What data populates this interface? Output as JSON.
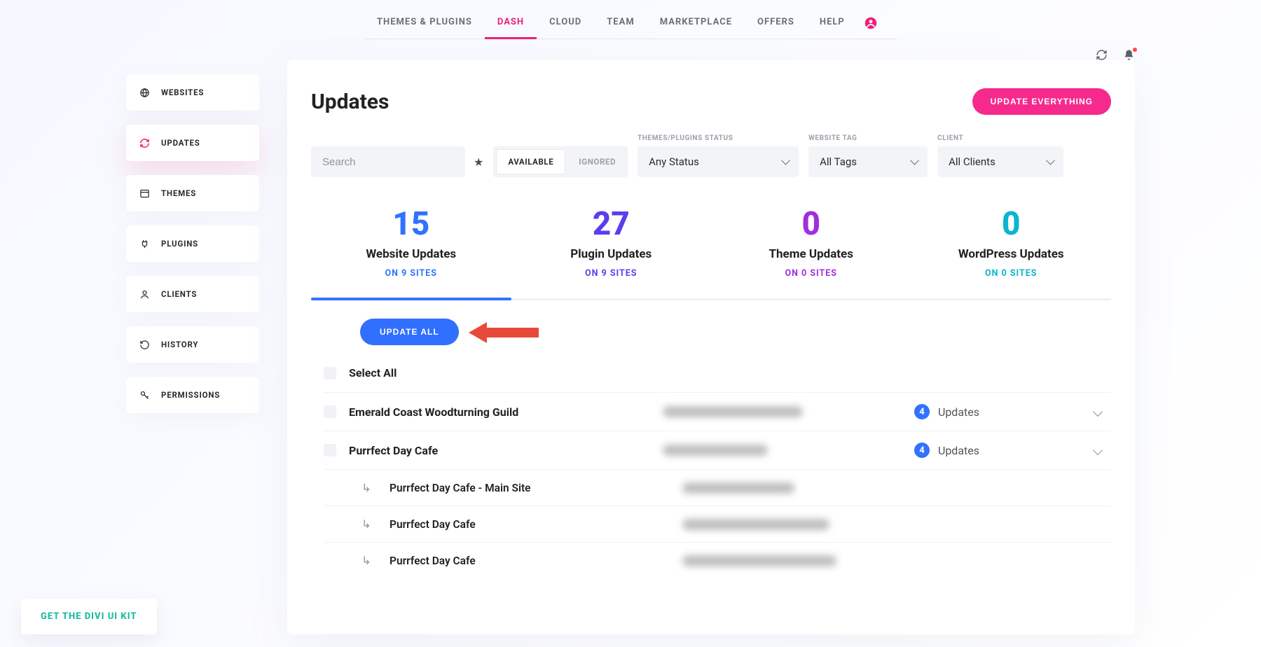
{
  "topnav": {
    "tabs": [
      "THEMES & PLUGINS",
      "DASH",
      "CLOUD",
      "TEAM",
      "MARKETPLACE",
      "OFFERS",
      "HELP"
    ],
    "active_index": 1
  },
  "sidebar": {
    "items": [
      {
        "label": "WEBSITES"
      },
      {
        "label": "UPDATES"
      },
      {
        "label": "THEMES"
      },
      {
        "label": "PLUGINS"
      },
      {
        "label": "CLIENTS"
      },
      {
        "label": "HISTORY"
      },
      {
        "label": "PERMISSIONS"
      }
    ],
    "active_index": 1
  },
  "page": {
    "title": "Updates",
    "update_everything": "UPDATE EVERYTHING"
  },
  "filters": {
    "search_placeholder": "Search",
    "toggle": {
      "available": "AVAILABLE",
      "ignored": "IGNORED"
    },
    "status_label": "THEMES/PLUGINS STATUS",
    "status_value": "Any Status",
    "tag_label": "WEBSITE TAG",
    "tag_value": "All Tags",
    "client_label": "CLIENT",
    "client_value": "All Clients"
  },
  "stats": [
    {
      "num": "15",
      "label": "Website Updates",
      "sub": "ON 9 SITES"
    },
    {
      "num": "27",
      "label": "Plugin Updates",
      "sub": "ON 9 SITES"
    },
    {
      "num": "0",
      "label": "Theme Updates",
      "sub": "ON 0 SITES"
    },
    {
      "num": "0",
      "label": "WordPress Updates",
      "sub": "ON 0 SITES"
    }
  ],
  "update_all": "UPDATE ALL",
  "list": {
    "select_all": "Select All",
    "updates_word": "Updates",
    "rows": [
      {
        "title": "Emerald Coast Woodturning Guild",
        "badge": "4"
      },
      {
        "title": "Purrfect Day Cafe",
        "badge": "4"
      }
    ],
    "subrows": [
      {
        "title": "Purrfect Day Cafe - Main Site"
      },
      {
        "title": "Purrfect Day Cafe"
      },
      {
        "title": "Purrfect Day Cafe"
      }
    ]
  },
  "promo": "GET THE DIVI UI KIT"
}
